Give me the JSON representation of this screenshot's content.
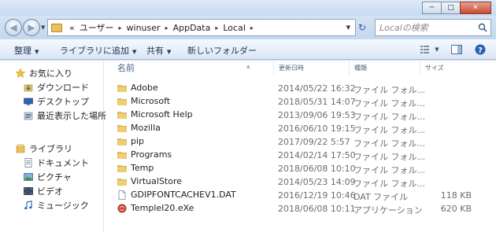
{
  "window": {
    "minimize_glyph": "─",
    "maximize_glyph": "□",
    "close_glyph": "✕"
  },
  "address": {
    "overflow_glyph": "«",
    "crumbs": [
      "ユーザー",
      "winuser",
      "AppData",
      "Local"
    ],
    "separator": "▸",
    "search_placeholder": "Localの検索"
  },
  "toolbar": {
    "organize": "整理",
    "add_to_library": "ライブラリに追加",
    "share": "共有",
    "new_folder": "新しいフォルダー"
  },
  "nav": {
    "favorites": "お気に入り",
    "downloads": "ダウンロード",
    "desktop": "デスクトップ",
    "recent_places": "最近表示した場所",
    "libraries": "ライブラリ",
    "documents": "ドキュメント",
    "pictures": "ピクチャ",
    "videos": "ビデオ",
    "music": "ミュージック"
  },
  "columns": {
    "name": "名前",
    "date": "更新日時",
    "type": "種類",
    "size": "サイズ"
  },
  "files": [
    {
      "name": "Adobe",
      "date": "2014/05/22 16:32",
      "type": "ファイル フォル...",
      "size": "",
      "icon": "folder-icon"
    },
    {
      "name": "Microsoft",
      "date": "2018/05/31 14:07",
      "type": "ファイル フォル...",
      "size": "",
      "icon": "folder-icon"
    },
    {
      "name": "Microsoft Help",
      "date": "2013/09/06 19:53",
      "type": "ファイル フォル...",
      "size": "",
      "icon": "folder-icon"
    },
    {
      "name": "Mozilla",
      "date": "2016/06/10 19:15",
      "type": "ファイル フォル...",
      "size": "",
      "icon": "folder-icon"
    },
    {
      "name": "pip",
      "date": "2017/09/22 5:57",
      "type": "ファイル フォル...",
      "size": "",
      "icon": "folder-icon"
    },
    {
      "name": "Programs",
      "date": "2014/02/14 17:50",
      "type": "ファイル フォル...",
      "size": "",
      "icon": "folder-icon"
    },
    {
      "name": "Temp",
      "date": "2018/06/08 10:10",
      "type": "ファイル フォル...",
      "size": "",
      "icon": "folder-icon"
    },
    {
      "name": "VirtualStore",
      "date": "2014/05/23 14:09",
      "type": "ファイル フォル...",
      "size": "",
      "icon": "folder-icon"
    },
    {
      "name": "GDIPFONTCACHEV1.DAT",
      "date": "2016/12/19 10:46",
      "type": "DAT ファイル",
      "size": "118 KB",
      "icon": "file-icon"
    },
    {
      "name": "TempleI20.eXe",
      "date": "2018/06/08 10:11",
      "type": "アプリケーション",
      "size": "620 KB",
      "icon": "app-icon"
    }
  ],
  "colors": {
    "folder": "#e9c25a",
    "chrome": "#c9daf0",
    "toolbar_text": "#1e3450"
  }
}
